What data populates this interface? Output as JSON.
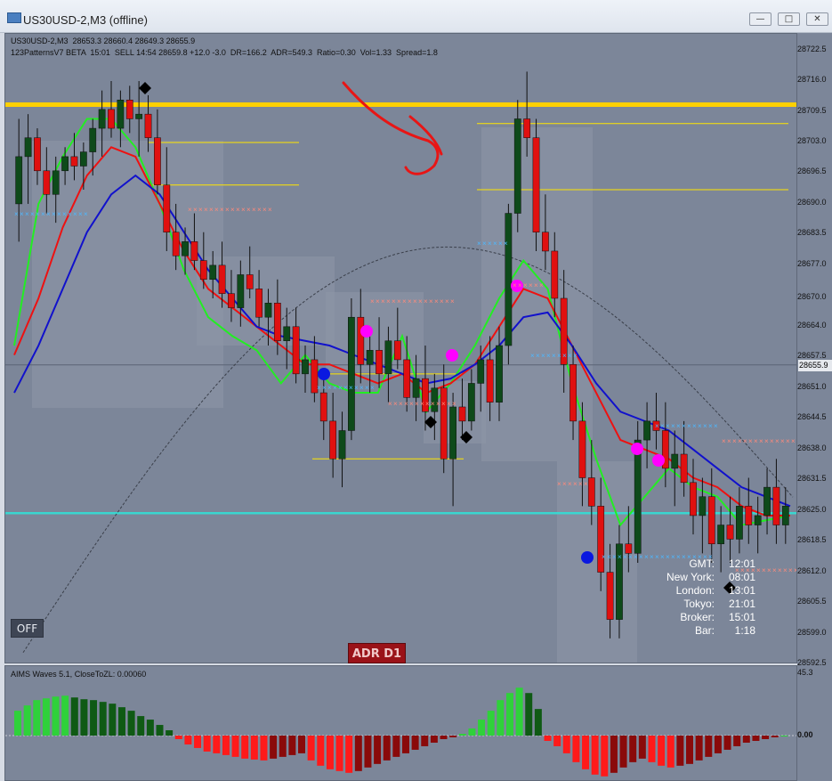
{
  "window": {
    "title": "US30USD-2,M3 (offline)",
    "buttons": [
      "minimize",
      "restore",
      "close"
    ]
  },
  "chart_header": {
    "symbol_line": "US30USD-2,M3  28653.3 28660.4 28649.3 28655.9",
    "indicator_line": "123PatternsV7 BETA  15:01  SELL 14:54 28659.8 +12.0 -3.0  DR=166.2  ADR=549.3  Ratio=0.30  Vol=1.33  Spread=1.8"
  },
  "price_axis": {
    "ticks": [
      "28722.5",
      "28716.0",
      "28709.5",
      "28703.0",
      "28696.5",
      "28690.0",
      "28683.5",
      "28677.0",
      "28670.0",
      "28664.0",
      "28657.5",
      "28651.0",
      "28644.5",
      "28638.0",
      "28631.5",
      "28625.0",
      "28618.5",
      "28612.0",
      "28605.5",
      "28599.0",
      "28592.5"
    ],
    "current_price": "28655.9"
  },
  "buttons": {
    "off": "OFF",
    "adr": "ADR D1"
  },
  "clock": [
    {
      "name": "GMT:",
      "time": "12:01"
    },
    {
      "name": "New York:",
      "time": "08:01"
    },
    {
      "name": "London:",
      "time": "13:01"
    },
    {
      "name": "Tokyo:",
      "time": "21:01"
    },
    {
      "name": "Broker:",
      "time": "15:01"
    },
    {
      "name": "Bar:",
      "time": "1:18"
    }
  ],
  "subwindow": {
    "label": "AIMS Waves 5.1, CloseToZL: 0.00060",
    "ticks": [
      "45.3",
      "0.00"
    ]
  },
  "colors": {
    "background": "#7c8699",
    "bull": "#0e4a1a",
    "bear": "#e01010",
    "resistance": "#ffd000",
    "support": "#3ad6d0",
    "fast_ma": "#22ee22",
    "mid_ma": "#ee1111",
    "slow_ma": "#1111cc"
  },
  "chart_data": {
    "type": "candlestick",
    "symbol": "US30USD-2",
    "timeframe": "M3",
    "ylim": [
      28592.5,
      28726
    ],
    "levels": {
      "resistance": 28711.0,
      "support": 28624.5
    },
    "candles": [
      [
        28690,
        28708,
        28682,
        28700
      ],
      [
        28700,
        28709,
        28690,
        28704
      ],
      [
        28704,
        28706,
        28694,
        28697
      ],
      [
        28697,
        28702,
        28688,
        28692
      ],
      [
        28692,
        28700,
        28686,
        28697
      ],
      [
        28697,
        28702,
        28694,
        28700
      ],
      [
        28700,
        28705,
        28695,
        28698
      ],
      [
        28698,
        28703,
        28693,
        28701
      ],
      [
        28701,
        28708,
        28696,
        28706
      ],
      [
        28706,
        28714,
        28700,
        28710
      ],
      [
        28710,
        28716,
        28704,
        28706
      ],
      [
        28706,
        28714,
        28702,
        28712
      ],
      [
        28712,
        28715,
        28705,
        28708
      ],
      [
        28708,
        28716,
        28700,
        28709
      ],
      [
        28709,
        28713,
        28701,
        28704
      ],
      [
        28704,
        28710,
        28692,
        28694
      ],
      [
        28694,
        28702,
        28680,
        28684
      ],
      [
        28684,
        28690,
        28676,
        28679
      ],
      [
        28679,
        28685,
        28675,
        28682
      ],
      [
        28682,
        28688,
        28676,
        28678
      ],
      [
        28678,
        28684,
        28672,
        28674
      ],
      [
        28674,
        28680,
        28670,
        28677
      ],
      [
        28677,
        28682,
        28668,
        28671
      ],
      [
        28671,
        28676,
        28665,
        28668
      ],
      [
        28668,
        28678,
        28664,
        28675
      ],
      [
        28675,
        28681,
        28670,
        28672
      ],
      [
        28672,
        28676,
        28664,
        28666
      ],
      [
        28666,
        28672,
        28660,
        28669
      ],
      [
        28669,
        28674,
        28658,
        28661
      ],
      [
        28661,
        28668,
        28655,
        28664
      ],
      [
        28664,
        28668,
        28652,
        28654
      ],
      [
        28654,
        28660,
        28650,
        28657
      ],
      [
        28657,
        28662,
        28648,
        28650
      ],
      [
        28650,
        28655,
        28640,
        28644
      ],
      [
        28644,
        28650,
        28632,
        28636
      ],
      [
        28636,
        28646,
        28630,
        28642
      ],
      [
        28642,
        28670,
        28640,
        28666
      ],
      [
        28666,
        28672,
        28652,
        28656
      ],
      [
        28656,
        28664,
        28650,
        28659
      ],
      [
        28659,
        28666,
        28651,
        28654
      ],
      [
        28654,
        28664,
        28648,
        28661
      ],
      [
        28661,
        28668,
        28655,
        28657
      ],
      [
        28657,
        28662,
        28646,
        28649
      ],
      [
        28649,
        28658,
        28644,
        28653
      ],
      [
        28653,
        28660,
        28642,
        28646
      ],
      [
        28646,
        28654,
        28640,
        28651
      ],
      [
        28651,
        28656,
        28633,
        28636
      ],
      [
        28636,
        28650,
        28626,
        28647
      ],
      [
        28647,
        28653,
        28640,
        28644
      ],
      [
        28644,
        28655,
        28642,
        28652
      ],
      [
        28652,
        28660,
        28646,
        28657
      ],
      [
        28657,
        28662,
        28644,
        28648
      ],
      [
        28648,
        28664,
        28644,
        28660
      ],
      [
        28660,
        28690,
        28656,
        28688
      ],
      [
        28688,
        28712,
        28684,
        28708
      ],
      [
        28708,
        28718,
        28700,
        28704
      ],
      [
        28704,
        28708,
        28680,
        28684
      ],
      [
        28684,
        28692,
        28676,
        28680
      ],
      [
        28680,
        28684,
        28666,
        28670
      ],
      [
        28670,
        28676,
        28650,
        28656
      ],
      [
        28656,
        28660,
        28640,
        28644
      ],
      [
        28644,
        28648,
        28626,
        28632
      ],
      [
        28632,
        28640,
        28622,
        28626
      ],
      [
        28626,
        28632,
        28608,
        28612
      ],
      [
        28612,
        28618,
        28598,
        28602
      ],
      [
        28602,
        28622,
        28598,
        28618
      ],
      [
        28618,
        28626,
        28612,
        28616
      ],
      [
        28616,
        28644,
        28614,
        28640
      ],
      [
        28640,
        28648,
        28634,
        28644
      ],
      [
        28644,
        28650,
        28638,
        28642
      ],
      [
        28642,
        28648,
        28630,
        28634
      ],
      [
        28634,
        28642,
        28626,
        28637
      ],
      [
        28637,
        28644,
        28628,
        28631
      ],
      [
        28631,
        28636,
        28620,
        28624
      ],
      [
        28624,
        28632,
        28616,
        28628
      ],
      [
        28628,
        28634,
        28614,
        28618
      ],
      [
        28618,
        28626,
        28612,
        28622
      ],
      [
        28622,
        28628,
        28614,
        28619
      ],
      [
        28619,
        28630,
        28616,
        28626
      ],
      [
        28626,
        28632,
        28618,
        28622
      ],
      [
        28622,
        28628,
        28616,
        28624
      ],
      [
        28624,
        28634,
        28620,
        28630
      ],
      [
        28630,
        28636,
        28618,
        28622
      ],
      [
        28622,
        28630,
        28618,
        28626
      ]
    ],
    "moving_averages": [
      {
        "color": "#22ee22",
        "values": [
          28660,
          28690,
          28700,
          28708,
          28708,
          28702,
          28690,
          28676,
          28666,
          28662,
          28659,
          28652,
          28658,
          28652,
          28650,
          28650,
          28662,
          28646,
          28652,
          28660,
          28670,
          28678,
          28672,
          28652,
          28636,
          28622,
          28628,
          28634,
          28630,
          28628,
          28622,
          28623,
          28624
        ]
      },
      {
        "color": "#ee1111",
        "values": [
          28658,
          28670,
          28685,
          28696,
          28702,
          28700,
          28690,
          28680,
          28672,
          28668,
          28664,
          28660,
          28656,
          28656,
          28654,
          28652,
          28654,
          28650,
          28652,
          28656,
          28664,
          28672,
          28670,
          28660,
          28650,
          28640,
          28638,
          28636,
          28632,
          28630,
          28626,
          28624,
          28624
        ]
      },
      {
        "color": "#1111cc",
        "values": [
          28650,
          28660,
          28672,
          28684,
          28692,
          28696,
          28692,
          28684,
          28676,
          28670,
          28664,
          28662,
          28661,
          28660,
          28658,
          28656,
          28654,
          28652,
          28653,
          28656,
          28660,
          28666,
          28667,
          28660,
          28652,
          28646,
          28644,
          28642,
          28638,
          28634,
          28630,
          28628,
          28626
        ]
      }
    ],
    "oscillator": {
      "label": "AIMS Waves 5.1",
      "values": [
        28,
        34,
        40,
        42,
        44,
        45,
        43,
        41,
        40,
        38,
        36,
        32,
        28,
        22,
        18,
        12,
        6,
        -4,
        -10,
        -14,
        -18,
        -20,
        -22,
        -24,
        -26,
        -27,
        -28,
        -26,
        -24,
        -22,
        -20,
        -28,
        -34,
        -38,
        -40,
        -42,
        -40,
        -36,
        -32,
        -28,
        -24,
        -20,
        -16,
        -12,
        -8,
        -4,
        -2,
        2,
        8,
        18,
        28,
        40,
        48,
        54,
        48,
        30,
        -6,
        -12,
        -20,
        -30,
        -38,
        -44,
        -46,
        -42,
        -36,
        -30,
        -26,
        -30,
        -34,
        -36,
        -34,
        -32,
        -28,
        -24,
        -20,
        -16,
        -12,
        -8,
        -6,
        -4,
        -2,
        0
      ]
    }
  }
}
